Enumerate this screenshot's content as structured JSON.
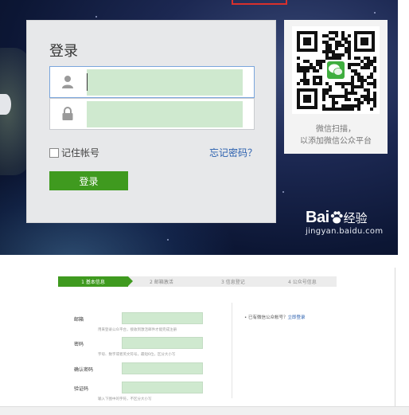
{
  "login_page": {
    "title": "登录",
    "username_icon": "user-icon",
    "password_icon": "lock-icon",
    "remember_label": "记住帐号",
    "forgot_link": "忘记密码？",
    "login_button": "登录",
    "qr_caption_line1": "微信扫描，",
    "qr_caption_line2": "以添加微信公众平台",
    "qr_code_icon": "qr-code-icon",
    "watermark_brand_left": "Bai",
    "watermark_brand_right": "经验",
    "watermark_url": "jingyan.baidu.com"
  },
  "register_page": {
    "steps": [
      {
        "label": "1 基本信息",
        "active": true
      },
      {
        "label": "2 邮箱激活",
        "active": false
      },
      {
        "label": "3 信息登记",
        "active": false
      },
      {
        "label": "4 公众号信息",
        "active": false
      }
    ],
    "fields": [
      {
        "label": "邮箱",
        "hint": "用来登录公众平台，接收到激活邮件才能完成注册"
      },
      {
        "label": "密码",
        "hint": "字母、数字或者英文符号，最短6位，区分大小写"
      },
      {
        "label": "确认密码",
        "hint": ""
      },
      {
        "label": "验证码",
        "hint": "输入下图中的字符，不区分大小写"
      }
    ],
    "already_text": "已有微信公众帐号？",
    "already_link": "立即登录"
  },
  "colors": {
    "accent_green": "#3f9a1f",
    "link_blue": "#2a5fae",
    "masked_field": "#cfe9cf",
    "panel_gray": "#e7e8ea"
  }
}
